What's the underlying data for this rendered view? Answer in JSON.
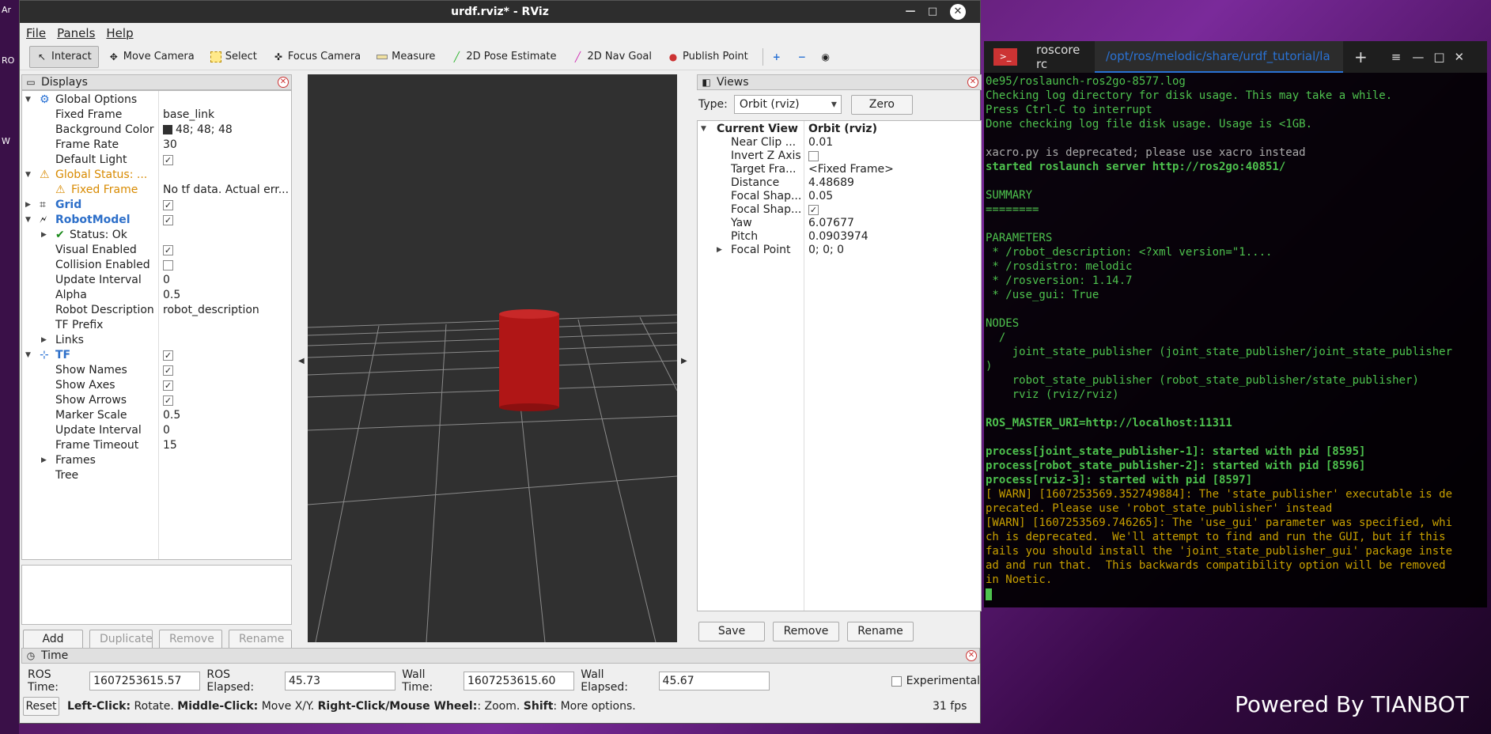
{
  "window": {
    "title": "urdf.rviz* - RViz"
  },
  "menu": [
    "File",
    "Panels",
    "Help"
  ],
  "toolbar": [
    {
      "label": "Interact",
      "icon": "cursor-icon"
    },
    {
      "label": "Move Camera",
      "icon": "move-icon"
    },
    {
      "label": "Select",
      "icon": "select-icon"
    },
    {
      "label": "Focus Camera",
      "icon": "focus-icon"
    },
    {
      "label": "Measure",
      "icon": "ruler-icon"
    },
    {
      "label": "2D Pose Estimate",
      "icon": "arrow-green-icon"
    },
    {
      "label": "2D Nav Goal",
      "icon": "arrow-pink-icon"
    },
    {
      "label": "Publish Point",
      "icon": "pin-icon"
    }
  ],
  "displays": {
    "title": "Displays",
    "global_options": "Global Options",
    "fixed_frame_label": "Fixed Frame",
    "fixed_frame_value": "base_link",
    "bg_label": "Background Color",
    "bg_value": "48; 48; 48",
    "frame_rate_label": "Frame Rate",
    "frame_rate_value": "30",
    "default_light_label": "Default Light",
    "global_status": "Global Status: ...",
    "gs_fixed_frame": "Fixed Frame",
    "gs_fixed_frame_value": "No tf data.  Actual err...",
    "grid": "Grid",
    "robot_model": "RobotModel",
    "status_ok": "Status: Ok",
    "visual_enabled": "Visual Enabled",
    "collision_enabled": "Collision Enabled",
    "update_interval": "Update Interval",
    "update_interval_value": "0",
    "alpha": "Alpha",
    "alpha_value": "0.5",
    "robot_description": "Robot Description",
    "robot_description_value": "robot_description",
    "tf_prefix": "TF Prefix",
    "links": "Links",
    "tf": "TF",
    "show_names": "Show Names",
    "show_axes": "Show Axes",
    "show_arrows": "Show Arrows",
    "marker_scale": "Marker Scale",
    "marker_scale_value": "0.5",
    "tf_update_interval": "Update Interval",
    "tf_update_interval_value": "0",
    "frame_timeout": "Frame Timeout",
    "frame_timeout_value": "15",
    "frames": "Frames",
    "tree_label": "Tree",
    "buttons": {
      "add": "Add",
      "duplicate": "Duplicate",
      "remove": "Remove",
      "rename": "Rename"
    }
  },
  "views": {
    "title": "Views",
    "type_label": "Type:",
    "type_value": "Orbit (rviz)",
    "zero": "Zero",
    "current_view": "Current View",
    "current_view_value": "Orbit (rviz)",
    "near_clip": "Near Clip ...",
    "near_clip_value": "0.01",
    "invert_z": "Invert Z Axis",
    "target_frame": "Target Fra...",
    "target_frame_value": "<Fixed Frame>",
    "distance": "Distance",
    "distance_value": "4.48689",
    "focal_shape1": "Focal Shap...",
    "focal_shape1_value": "0.05",
    "focal_shape2": "Focal Shap...",
    "yaw": "Yaw",
    "yaw_value": "6.07677",
    "pitch": "Pitch",
    "pitch_value": "0.0903974",
    "focal_point": "Focal Point",
    "focal_point_value": "0; 0; 0",
    "buttons": {
      "save": "Save",
      "remove": "Remove",
      "rename": "Rename"
    }
  },
  "time": {
    "title": "Time",
    "ros_time_label": "ROS Time:",
    "ros_time": "1607253615.57",
    "ros_elapsed_label": "ROS Elapsed:",
    "ros_elapsed": "45.73",
    "wall_time_label": "Wall Time:",
    "wall_time": "1607253615.60",
    "wall_elapsed_label": "Wall Elapsed:",
    "wall_elapsed": "45.67",
    "experimental": "Experimental",
    "reset": "Reset",
    "hint_lc": "Left-Click:",
    "hint_lc_t": " Rotate.",
    "hint_mc": "Middle-Click:",
    "hint_mc_t": " Move X/Y.",
    "hint_rc": "Right-Click/Mouse Wheel:",
    "hint_rc_t": ": Zoom.",
    "hint_sh": "Shift",
    "hint_sh_t": ": More options.",
    "fps": "31 fps"
  },
  "terminal": {
    "tab1": "roscore rc",
    "tab2": "/opt/ros/melodic/share/urdf_tutorial/la",
    "lines": [
      {
        "t": "0e95/roslaunch-ros2go-8577.log",
        "c": ""
      },
      {
        "t": "Checking log directory for disk usage. This may take a while.",
        "c": ""
      },
      {
        "t": "Press Ctrl-C to interrupt",
        "c": ""
      },
      {
        "t": "Done checking log file disk usage. Usage is <1GB.",
        "c": ""
      },
      {
        "t": "",
        "c": ""
      },
      {
        "t": "xacro.py is deprecated; please use xacro instead",
        "c": "g"
      },
      {
        "t": "started roslaunch server http://ros2go:40851/",
        "c": "b"
      },
      {
        "t": "",
        "c": ""
      },
      {
        "t": "SUMMARY",
        "c": ""
      },
      {
        "t": "========",
        "c": ""
      },
      {
        "t": "",
        "c": ""
      },
      {
        "t": "PARAMETERS",
        "c": ""
      },
      {
        "t": " * /robot_description: <?xml version=\"1....",
        "c": ""
      },
      {
        "t": " * /rosdistro: melodic",
        "c": ""
      },
      {
        "t": " * /rosversion: 1.14.7",
        "c": ""
      },
      {
        "t": " * /use_gui: True",
        "c": ""
      },
      {
        "t": "",
        "c": ""
      },
      {
        "t": "NODES",
        "c": ""
      },
      {
        "t": "  /",
        "c": ""
      },
      {
        "t": "    joint_state_publisher (joint_state_publisher/joint_state_publisher",
        "c": ""
      },
      {
        "t": ")",
        "c": ""
      },
      {
        "t": "    robot_state_publisher (robot_state_publisher/state_publisher)",
        "c": ""
      },
      {
        "t": "    rviz (rviz/rviz)",
        "c": ""
      },
      {
        "t": "",
        "c": ""
      },
      {
        "t": "ROS_MASTER_URI=http://localhost:11311",
        "c": "b"
      },
      {
        "t": "",
        "c": ""
      },
      {
        "t": "process[joint_state_publisher-1]: started with pid [8595]",
        "c": "b"
      },
      {
        "t": "process[robot_state_publisher-2]: started with pid [8596]",
        "c": "b"
      },
      {
        "t": "process[rviz-3]: started with pid [8597]",
        "c": "b"
      },
      {
        "t": "[ WARN] [1607253569.352749884]: The 'state_publisher' executable is de",
        "c": "w"
      },
      {
        "t": "precated. Please use 'robot_state_publisher' instead",
        "c": "w"
      },
      {
        "t": "[WARN] [1607253569.746265]: The 'use_gui' parameter was specified, whi",
        "c": "w"
      },
      {
        "t": "ch is deprecated.  We'll attempt to find and run the GUI, but if this",
        "c": "w"
      },
      {
        "t": "fails you should install the 'joint_state_publisher_gui' package inste",
        "c": "w"
      },
      {
        "t": "ad and run that.  This backwards compatibility option will be removed",
        "c": "w"
      },
      {
        "t": "in Noetic.",
        "c": "w"
      }
    ]
  },
  "desktop": {
    "powered": "Powered By TIANBOT",
    "left_icons": [
      "Ar",
      "RO",
      "W"
    ]
  }
}
